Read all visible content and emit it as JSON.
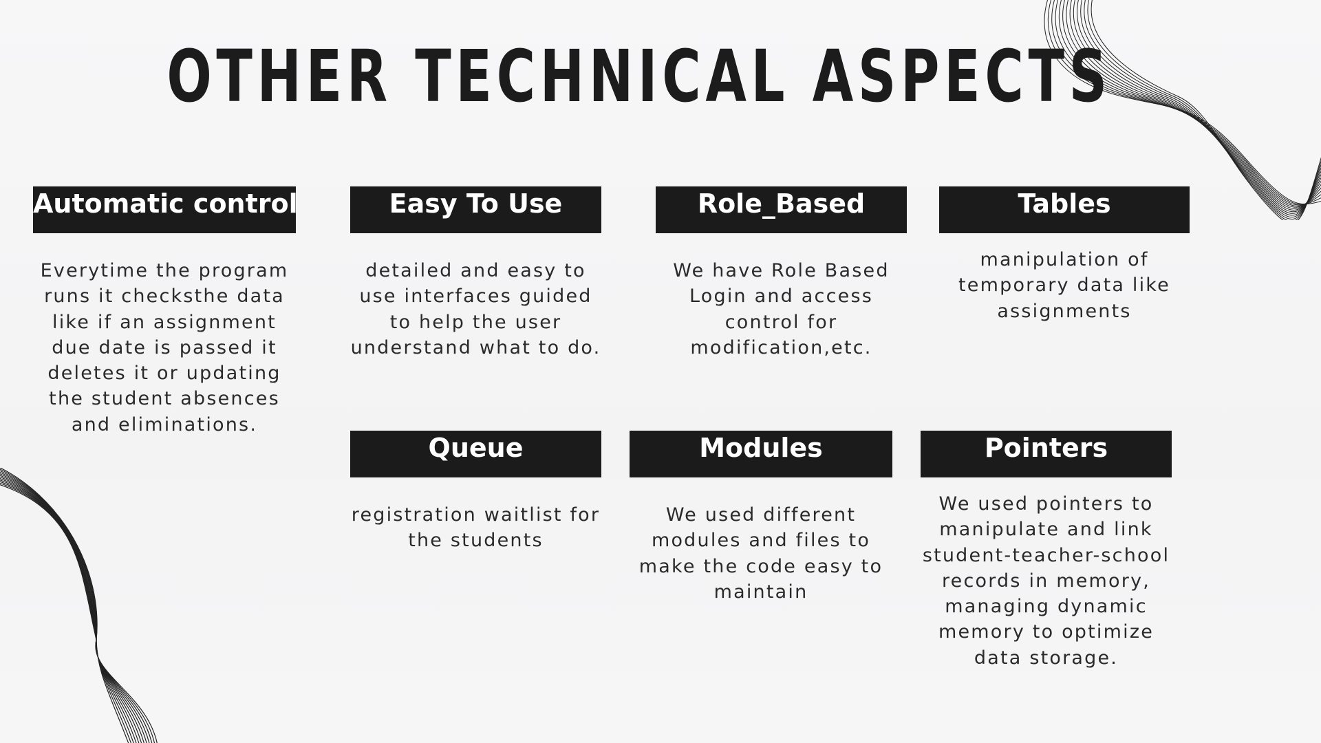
{
  "slide": {
    "title": "OTHER TECHNICAL ASPECTS",
    "colors": {
      "header_bg": "#1b1b1b",
      "header_text": "#ffffff",
      "text": "#1e1e1e",
      "background": "#f5f5f6"
    }
  },
  "cards": [
    {
      "heading": "Automatic control",
      "body": "Everytime the program runs it checksthe data like if an assignment due date is passed it deletes it or updating the student absences and eliminations."
    },
    {
      "heading": "Easy To Use",
      "body": "detailed and easy to use interfaces guided to help the user understand what to do."
    },
    {
      "heading": "Role_Based",
      "body": "We have Role Based Login and access control for modification,etc."
    },
    {
      "heading": "Tables",
      "body": "manipulation of temporary data like assignments"
    },
    {
      "heading": "Queue",
      "body": "registration waitlist for the students"
    },
    {
      "heading": "Modules",
      "body": "We used different modules and files to make the code easy to maintain"
    },
    {
      "heading": "Pointers",
      "body": "We used pointers to manipulate and link student-teacher-school records in memory, managing dynamic memory to optimize data storage."
    }
  ],
  "decorations": [
    "wave-lines-top-right",
    "wave-lines-bottom-left"
  ]
}
